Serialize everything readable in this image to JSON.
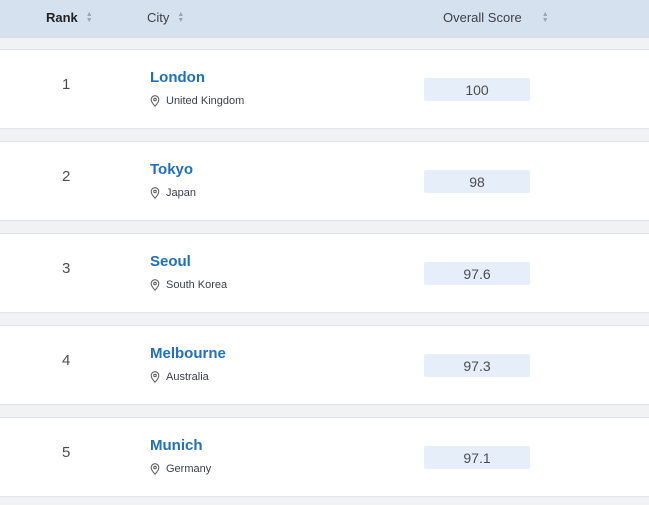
{
  "table": {
    "headers": {
      "rank": "Rank",
      "city": "City",
      "score": "Overall Score",
      "sort_up": "▲",
      "sort_down": "▼"
    },
    "rows": [
      {
        "rank": "1",
        "city": "London",
        "country": "United Kingdom",
        "score": "100"
      },
      {
        "rank": "2",
        "city": "Tokyo",
        "country": "Japan",
        "score": "98"
      },
      {
        "rank": "3",
        "city": "Seoul",
        "country": "South Korea",
        "score": "97.6"
      },
      {
        "rank": "4",
        "city": "Melbourne",
        "country": "Australia",
        "score": "97.3"
      },
      {
        "rank": "5",
        "city": "Munich",
        "country": "Germany",
        "score": "97.1"
      }
    ]
  },
  "colors": {
    "header_bg": "#d6e1f0",
    "city_link": "#1f6fbf",
    "score_bg": "#e6eef9",
    "page_bg": "#f1f2f4"
  },
  "icons": {
    "sort": "sort-arrows-icon",
    "location": "map-pin-icon"
  }
}
